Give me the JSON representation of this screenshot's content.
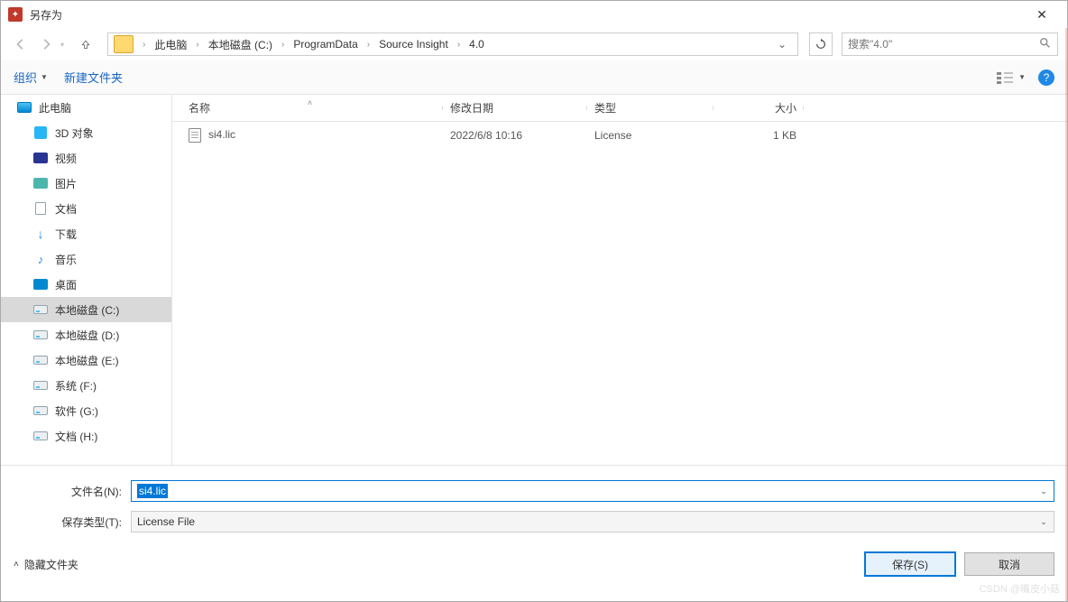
{
  "window": {
    "title": "另存为"
  },
  "breadcrumb": {
    "items": [
      "此电脑",
      "本地磁盘 (C:)",
      "ProgramData",
      "Source Insight",
      "4.0"
    ]
  },
  "search": {
    "placeholder": "搜索\"4.0\""
  },
  "toolbar": {
    "organize": "组织",
    "new_folder": "新建文件夹"
  },
  "sidebar": {
    "items": [
      {
        "label": "此电脑",
        "icon": "monitor",
        "indent": false
      },
      {
        "label": "3D 对象",
        "icon": "3d",
        "indent": true
      },
      {
        "label": "视频",
        "icon": "video",
        "indent": true
      },
      {
        "label": "图片",
        "icon": "pic",
        "indent": true
      },
      {
        "label": "文档",
        "icon": "doc",
        "indent": true
      },
      {
        "label": "下载",
        "icon": "down",
        "indent": true
      },
      {
        "label": "音乐",
        "icon": "music",
        "indent": true
      },
      {
        "label": "桌面",
        "icon": "desk",
        "indent": true
      },
      {
        "label": "本地磁盘 (C:)",
        "icon": "drive",
        "indent": true,
        "selected": true
      },
      {
        "label": "本地磁盘 (D:)",
        "icon": "drive",
        "indent": true
      },
      {
        "label": "本地磁盘 (E:)",
        "icon": "drive",
        "indent": true
      },
      {
        "label": "系统 (F:)",
        "icon": "drive",
        "indent": true
      },
      {
        "label": "软件 (G:)",
        "icon": "drive",
        "indent": true
      },
      {
        "label": "文档 (H:)",
        "icon": "drive",
        "indent": true
      }
    ]
  },
  "columns": {
    "name": "名称",
    "date": "修改日期",
    "type": "类型",
    "size": "大小"
  },
  "files": [
    {
      "name": "si4.lic",
      "date": "2022/6/8 10:16",
      "type": "License",
      "size": "1 KB"
    }
  ],
  "form": {
    "filename_label": "文件名(N):",
    "filename_value": "si4.lic",
    "filetype_label": "保存类型(T):",
    "filetype_value": "License File"
  },
  "footer": {
    "hide_folders": "隐藏文件夹",
    "save": "保存(S)",
    "cancel": "取消"
  },
  "watermark": "CSDN @嘴皮小菇"
}
